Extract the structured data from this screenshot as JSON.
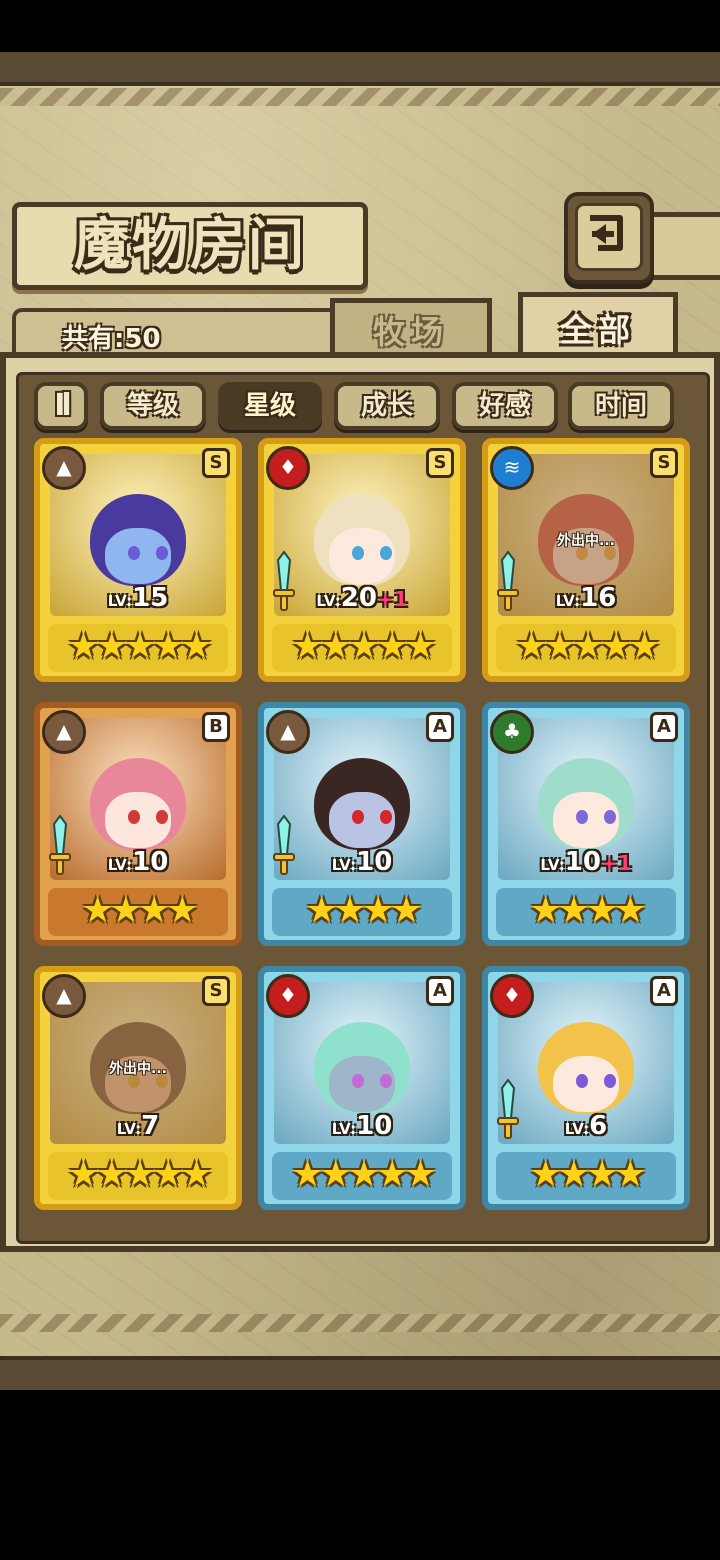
{
  "header": {
    "title": "魔物房间",
    "back_icon": "return-arrow-icon"
  },
  "summary": {
    "count_text": "共有:50"
  },
  "tabs": [
    {
      "label": "牧场",
      "active": false
    },
    {
      "label": "全部",
      "active": true
    }
  ],
  "sort": {
    "toggle_label": "Il",
    "options": [
      {
        "label": "等级",
        "active": false
      },
      {
        "label": "星级",
        "active": true
      },
      {
        "label": "成长",
        "active": false
      },
      {
        "label": "好感",
        "active": false
      },
      {
        "label": "时间",
        "active": false
      }
    ]
  },
  "monsters": [
    {
      "element": "earth",
      "element_icon": "mountain-icon",
      "rank": "S",
      "frame": "gold",
      "lv_prefix": "LV:",
      "level": "15",
      "bonus": "",
      "stars": "★★★★★",
      "weapon": false,
      "status": "",
      "colors": {
        "hair": "#4b3a9e",
        "skin": "#8fb6ee",
        "eye": "#6b5bd6"
      }
    },
    {
      "element": "fire",
      "element_icon": "flame-icon",
      "rank": "S",
      "frame": "gold",
      "lv_prefix": "LV:",
      "level": "20",
      "bonus": "+1",
      "stars": "★★★★★",
      "weapon": true,
      "status": "",
      "colors": {
        "hair": "#efe1bf",
        "skin": "#fde9dd",
        "eye": "#4aa6d8"
      }
    },
    {
      "element": "water",
      "element_icon": "water-waves-icon",
      "rank": "S",
      "frame": "gold",
      "lv_prefix": "LV:",
      "level": "16",
      "bonus": "",
      "stars": "★★★★★",
      "weapon": true,
      "status": "外出中...",
      "colors": {
        "hair": "#d0473a",
        "skin": "#f7d8c7",
        "eye": "#e8a030"
      }
    },
    {
      "element": "earth",
      "element_icon": "mountain-icon",
      "rank": "B",
      "frame": "bronze",
      "lv_prefix": "LV:",
      "level": "10",
      "bonus": "",
      "stars": "★★★★",
      "weapon": true,
      "status": "",
      "colors": {
        "hair": "#e8879a",
        "skin": "#fde6dd",
        "eye": "#d03a3a"
      }
    },
    {
      "element": "earth",
      "element_icon": "mountain-icon",
      "rank": "A",
      "frame": "blue",
      "lv_prefix": "LV:",
      "level": "10",
      "bonus": "",
      "stars": "★★★★",
      "weapon": true,
      "status": "",
      "colors": {
        "hair": "#3a2622",
        "skin": "#b9c3e4",
        "eye": "#d4262c"
      }
    },
    {
      "element": "nature",
      "element_icon": "leaf-icon",
      "rank": "A",
      "frame": "blue",
      "lv_prefix": "LV:",
      "level": "10",
      "bonus": "+1",
      "stars": "★★★★",
      "weapon": false,
      "status": "",
      "colors": {
        "hair": "#9fdccb",
        "skin": "#fde9dd",
        "eye": "#7a6ad8"
      }
    },
    {
      "element": "earth",
      "element_icon": "mountain-icon",
      "rank": "S",
      "frame": "gold",
      "lv_prefix": "LV:",
      "level": "7",
      "bonus": "",
      "stars": "★★★★★",
      "weapon": false,
      "status": "外出中...",
      "colors": {
        "hair": "#6b4a2a",
        "skin": "#e8b48e",
        "eye": "#d0a020"
      }
    },
    {
      "element": "fire",
      "element_icon": "flame-icon",
      "rank": "A",
      "frame": "blue",
      "lv_prefix": "LV:",
      "level": "10",
      "bonus": "",
      "stars": "★★★★★",
      "weapon": false,
      "status": "",
      "colors": {
        "hair": "#8fe0cc",
        "skin": "#9fb5c9",
        "eye": "#c36ad8"
      }
    },
    {
      "element": "fire",
      "element_icon": "flame-icon",
      "rank": "A",
      "frame": "blue",
      "lv_prefix": "LV:",
      "level": "6",
      "bonus": "",
      "stars": "★★★★",
      "weapon": true,
      "status": "",
      "colors": {
        "hair": "#f2c24a",
        "skin": "#fde9dd",
        "eye": "#7a5ad8"
      }
    }
  ]
}
